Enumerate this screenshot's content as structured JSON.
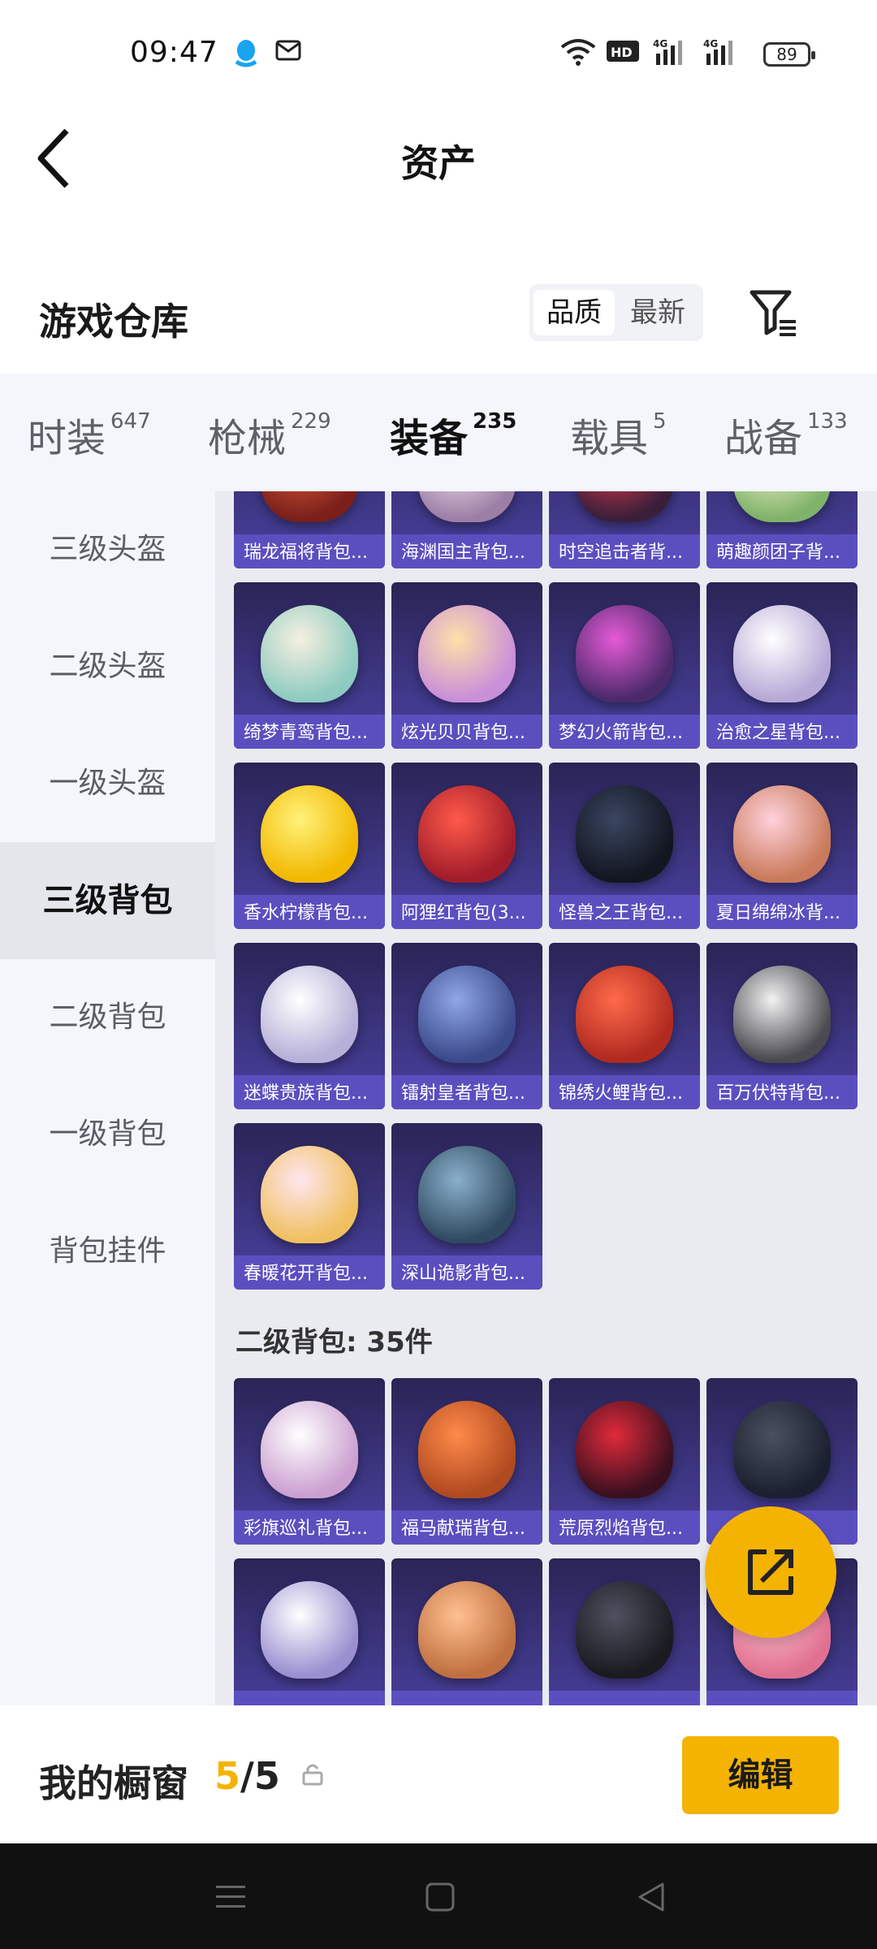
{
  "status_bar": {
    "time": "09:47",
    "battery": "89"
  },
  "header": {
    "title": "资产"
  },
  "section": {
    "title": "游戏仓库",
    "sort_options": [
      "品质",
      "最新"
    ],
    "selected_sort": "品质"
  },
  "tabs": [
    {
      "label": "时装",
      "count": "647"
    },
    {
      "label": "枪械",
      "count": "229"
    },
    {
      "label": "装备",
      "count": "235",
      "active": true
    },
    {
      "label": "载具",
      "count": "5"
    },
    {
      "label": "战备",
      "count": "133"
    }
  ],
  "sidebar": [
    {
      "label": "三级头盔"
    },
    {
      "label": "二级头盔"
    },
    {
      "label": "一级头盔"
    },
    {
      "label": "三级背包",
      "active": true
    },
    {
      "label": "二级背包"
    },
    {
      "label": "一级背包"
    },
    {
      "label": "背包挂件"
    }
  ],
  "items_level3": [
    {
      "name": "瑞龙福将背包...",
      "c1": "#e05a3a",
      "c2": "#7a1f1a"
    },
    {
      "name": "海渊国主背包...",
      "c1": "#f4e6f0",
      "c2": "#9d7fa6"
    },
    {
      "name": "时空追击者背...",
      "c1": "#e23b4c",
      "c2": "#3b1f3a"
    },
    {
      "name": "萌趣颜团子背...",
      "c1": "#f6f1c8",
      "c2": "#7fb36a"
    },
    {
      "name": "绮梦青鸾背包...",
      "c1": "#f6f0e0",
      "c2": "#8ecbc0"
    },
    {
      "name": "炫光贝贝背包...",
      "c1": "#ffe0a8",
      "c2": "#c98fd9"
    },
    {
      "name": "梦幻火箭背包...",
      "c1": "#e65ad6",
      "c2": "#4b2a6b"
    },
    {
      "name": "治愈之星背包...",
      "c1": "#ffffff",
      "c2": "#b6a9d6"
    },
    {
      "name": "香水柠檬背包...",
      "c1": "#fff27a",
      "c2": "#f2b800"
    },
    {
      "name": "阿狸红背包(3...",
      "c1": "#ff5a4a",
      "c2": "#a01c2a"
    },
    {
      "name": "怪兽之王背包...",
      "c1": "#3a4560",
      "c2": "#121620"
    },
    {
      "name": "夏日绵绵冰背...",
      "c1": "#ffd1dc",
      "c2": "#c97a5a"
    },
    {
      "name": "迷蝶贵族背包...",
      "c1": "#ffffff",
      "c2": "#b7b0d8"
    },
    {
      "name": "镭射皇者背包...",
      "c1": "#8fa6e8",
      "c2": "#3a4a8a"
    },
    {
      "name": "锦绣火鲤背包...",
      "c1": "#ff6a4a",
      "c2": "#b02a20"
    },
    {
      "name": "百万伏特背包...",
      "c1": "#f2f2f2",
      "c2": "#4a4a50"
    },
    {
      "name": "春暖花开背包...",
      "c1": "#ffe6f0",
      "c2": "#f0c060"
    },
    {
      "name": "深山诡影背包...",
      "c1": "#8ab0cc",
      "c2": "#2f4a60"
    }
  ],
  "group_level2_title": "二级背包: 35件",
  "items_level2": [
    {
      "name": "彩旗巡礼背包...",
      "c1": "#ffffff",
      "c2": "#cba0d0"
    },
    {
      "name": "福马献瑞背包...",
      "c1": "#ff8a4a",
      "c2": "#b04a20"
    },
    {
      "name": "荒原烈焰背包...",
      "c1": "#e02a3a",
      "c2": "#3a1020"
    },
    {
      "name": "",
      "c1": "#4a5060",
      "c2": "#1a2030"
    },
    {
      "name": "",
      "c1": "#ffffff",
      "c2": "#9a8fd0"
    },
    {
      "name": "",
      "c1": "#ffc090",
      "c2": "#c07040"
    },
    {
      "name": "",
      "c1": "#505060",
      "c2": "#1a1a20"
    },
    {
      "name": "",
      "c1": "#ffc0d0",
      "c2": "#e07090"
    }
  ],
  "bottom": {
    "label": "我的橱窗",
    "current": "5",
    "total": "/5",
    "edit": "编辑"
  },
  "colors": {
    "accent": "#f5b301",
    "card_bg": "#3c3580",
    "card_label_bg": "#5b4fc0"
  }
}
